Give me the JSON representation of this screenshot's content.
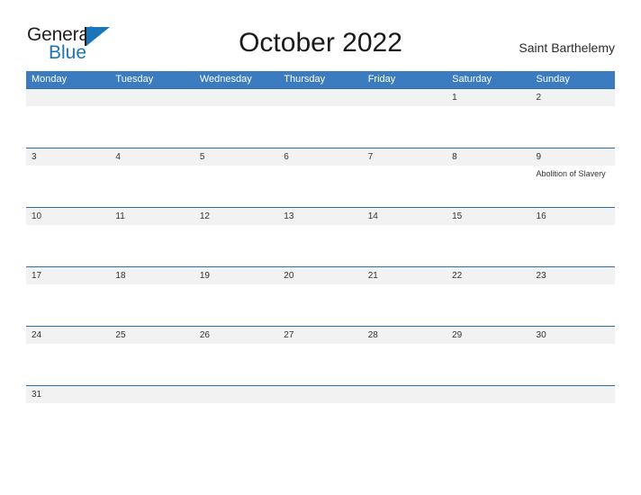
{
  "header": {
    "logo": {
      "word_one": "General",
      "word_two": "Blue",
      "flag_icon": "triangle-flag-icon"
    },
    "title": "October 2022",
    "location": "Saint Barthelemy"
  },
  "calendar": {
    "weekday_headers": [
      "Monday",
      "Tuesday",
      "Wednesday",
      "Thursday",
      "Friday",
      "Saturday",
      "Sunday"
    ],
    "colors": {
      "header_blue": "#3b7cc0",
      "divider_blue": "#2e6da4",
      "date_strip_gray": "#f2f2f2",
      "logo_blue": "#1b75bb",
      "text_dark": "#333333"
    },
    "weeks": [
      {
        "days": [
          {
            "date": "",
            "event": ""
          },
          {
            "date": "",
            "event": ""
          },
          {
            "date": "",
            "event": ""
          },
          {
            "date": "",
            "event": ""
          },
          {
            "date": "",
            "event": ""
          },
          {
            "date": "1",
            "event": ""
          },
          {
            "date": "2",
            "event": ""
          }
        ]
      },
      {
        "days": [
          {
            "date": "3",
            "event": ""
          },
          {
            "date": "4",
            "event": ""
          },
          {
            "date": "5",
            "event": ""
          },
          {
            "date": "6",
            "event": ""
          },
          {
            "date": "7",
            "event": ""
          },
          {
            "date": "8",
            "event": ""
          },
          {
            "date": "9",
            "event": "Abolition of Slavery"
          }
        ]
      },
      {
        "days": [
          {
            "date": "10",
            "event": ""
          },
          {
            "date": "11",
            "event": ""
          },
          {
            "date": "12",
            "event": ""
          },
          {
            "date": "13",
            "event": ""
          },
          {
            "date": "14",
            "event": ""
          },
          {
            "date": "15",
            "event": ""
          },
          {
            "date": "16",
            "event": ""
          }
        ]
      },
      {
        "days": [
          {
            "date": "17",
            "event": ""
          },
          {
            "date": "18",
            "event": ""
          },
          {
            "date": "19",
            "event": ""
          },
          {
            "date": "20",
            "event": ""
          },
          {
            "date": "21",
            "event": ""
          },
          {
            "date": "22",
            "event": ""
          },
          {
            "date": "23",
            "event": ""
          }
        ]
      },
      {
        "days": [
          {
            "date": "24",
            "event": ""
          },
          {
            "date": "25",
            "event": ""
          },
          {
            "date": "26",
            "event": ""
          },
          {
            "date": "27",
            "event": ""
          },
          {
            "date": "28",
            "event": ""
          },
          {
            "date": "29",
            "event": ""
          },
          {
            "date": "30",
            "event": ""
          }
        ]
      },
      {
        "days": [
          {
            "date": "31",
            "event": ""
          },
          {
            "date": "",
            "event": ""
          },
          {
            "date": "",
            "event": ""
          },
          {
            "date": "",
            "event": ""
          },
          {
            "date": "",
            "event": ""
          },
          {
            "date": "",
            "event": ""
          },
          {
            "date": "",
            "event": ""
          }
        ]
      }
    ]
  }
}
